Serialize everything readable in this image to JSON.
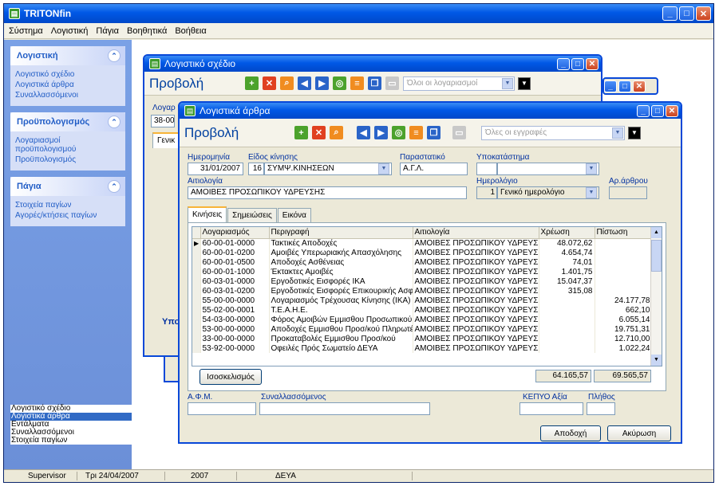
{
  "app": {
    "title": "TRITONfin"
  },
  "menu": [
    "Σύστημα",
    "Λογιστική",
    "Πάγια",
    "Βοηθητικά",
    "Βοήθεια"
  ],
  "sidebar": {
    "groups": [
      {
        "title": "Λογιστική",
        "items": [
          "Λογιστικό σχέδιο",
          "Λογιστικά άρθρα",
          "Συναλλασσόμενοι"
        ]
      },
      {
        "title": "Προϋπολογισμός",
        "items": [
          "Λογαριασμοί προϋπολογισμού",
          "Προϋπολογισμός"
        ]
      },
      {
        "title": "Πάγια",
        "items": [
          "Στοιχεία παγίων",
          "Αγορές/κτήσεις παγίων"
        ]
      }
    ],
    "open_windows": [
      "Λογιστικό σχέδιο",
      "Λογιστικά άρθρα",
      "Εντάλματα",
      "Συναλλασσόμενοι",
      "Στοιχεία παγίων"
    ]
  },
  "statusbar": {
    "user": "Supervisor",
    "date": "Τρι 24/04/2007",
    "year": "2007",
    "company": "ΔΕΥΑ"
  },
  "win_plan": {
    "title": "Λογιστικό σχέδιο",
    "view_label": "Προβολή",
    "filter": "Όλοι οι λογαριασμοί",
    "field_label": "Λογαρ",
    "field_value": "38-00",
    "tab": "Γενικ",
    "footer_label": "Υπο"
  },
  "win_articles": {
    "title": "Λογιστικά άρθρα",
    "view_label": "Προβολή",
    "filter": "Όλες οι εγγραφές",
    "labels": {
      "date": "Ημερομηνία",
      "movement": "Είδος κίνησης",
      "document": "Παραστατικό",
      "branch": "Υποκατάστημα",
      "reason": "Αιτιολογία",
      "journal": "Ημερολόγιο",
      "article_no": "Αρ.άρθρου",
      "afm": "Α.Φ.Μ.",
      "partner": "Συναλλασσόμενος",
      "kepyo": "ΚΕΠΥΟ Αξία",
      "count": "Πλήθος"
    },
    "values": {
      "date": "31/01/2007",
      "movement_code": "16",
      "movement_name": "ΣΥΜΨ.ΚΙΝΗΣΕΩΝ",
      "document": "Α.Γ.Λ.",
      "reason": "ΑΜΟΙΒΕΣ ΠΡΟΣΩΠΙΚΟΥ ΥΔΡΕΥΣΗΣ",
      "journal_code": "1",
      "journal_name": "Γενικό ημερολόγιο"
    },
    "tabs": [
      "Κινήσεις",
      "Σημειώσεις",
      "Εικόνα"
    ],
    "columns": [
      "Λογαριασμός",
      "Περιγραφή",
      "Αιτιολογία",
      "Χρέωση",
      "Πίστωση"
    ],
    "rows": [
      [
        "60-00-01-0000",
        "Τακτικές Αποδοχές",
        "ΑΜΟΙΒΕΣ ΠΡΟΣΩΠΙΚΟΥ ΥΔΡΕΥΣΗΣ",
        "48.072,62",
        ""
      ],
      [
        "60-00-01-0200",
        "Αμοιβές Υπερωριακής Απασχόλησης",
        "ΑΜΟΙΒΕΣ ΠΡΟΣΩΠΙΚΟΥ ΥΔΡΕΥΣΗΣ",
        "4.654,74",
        ""
      ],
      [
        "60-00-01-0500",
        "Αποδοχές Ασθένειας",
        "ΑΜΟΙΒΕΣ ΠΡΟΣΩΠΙΚΟΥ ΥΔΡΕΥΣΗΣ",
        "74,01",
        ""
      ],
      [
        "60-00-01-1000",
        "Έκτακτες Αμοιβές",
        "ΑΜΟΙΒΕΣ ΠΡΟΣΩΠΙΚΟΥ ΥΔΡΕΥΣΗΣ",
        "1.401,75",
        ""
      ],
      [
        "60-03-01-0000",
        "Εργοδοτικές Εισφορές ΙΚΑ",
        "ΑΜΟΙΒΕΣ ΠΡΟΣΩΠΙΚΟΥ ΥΔΡΕΥΣΗΣ",
        "15.047,37",
        ""
      ],
      [
        "60-03-01-0200",
        "Εργοδοτικές Εισφορές Επικουρικής Ασφάλι",
        "ΑΜΟΙΒΕΣ ΠΡΟΣΩΠΙΚΟΥ ΥΔΡΕΥΣΗΣ",
        "315,08",
        ""
      ],
      [
        "55-00-00-0000",
        "Λογαριασμός Τρέχουσας Κίνησης (ΙΚΑ)",
        "ΑΜΟΙΒΕΣ ΠΡΟΣΩΠΙΚΟΥ ΥΔΡΕΥΣΗΣ",
        "",
        "24.177,78"
      ],
      [
        "55-02-00-0001",
        "Τ.Ε.Α.Η.Ε.",
        "ΑΜΟΙΒΕΣ ΠΡΟΣΩΠΙΚΟΥ ΥΔΡΕΥΣΗΣ",
        "",
        "662,10"
      ],
      [
        "54-03-00-0000",
        "Φόρος Αμοιβών Εμμισθου Προσωπικού",
        "ΑΜΟΙΒΕΣ ΠΡΟΣΩΠΙΚΟΥ ΥΔΡΕΥΣΗΣ",
        "",
        "6.055,14"
      ],
      [
        "53-00-00-0000",
        "Αποδοχές Εμμισθου Προσ/κού Πληρωτέες",
        "ΑΜΟΙΒΕΣ ΠΡΟΣΩΠΙΚΟΥ ΥΔΡΕΥΣΗΣ",
        "",
        "19.751,31"
      ],
      [
        "33-00-00-0000",
        "Προκαταβολές Εμμισθου Προσ/κού",
        "ΑΜΟΙΒΕΣ ΠΡΟΣΩΠΙΚΟΥ ΥΔΡΕΥΣΗΣ",
        "",
        "12.710,00"
      ],
      [
        "53-92-00-0000",
        "Οφειλές Πρός Σωματείο ΔΕΥΑ",
        "ΑΜΟΙΒΕΣ ΠΡΟΣΩΠΙΚΟΥ ΥΔΡΕΥΣΗΣ",
        "",
        "1.022,24"
      ]
    ],
    "balance_button": "Ισοσκελισμός",
    "total_debit": "64.165,57",
    "total_credit": "69.565,57",
    "ok_button": "Αποδοχή",
    "cancel_button": "Ακύρωση"
  }
}
